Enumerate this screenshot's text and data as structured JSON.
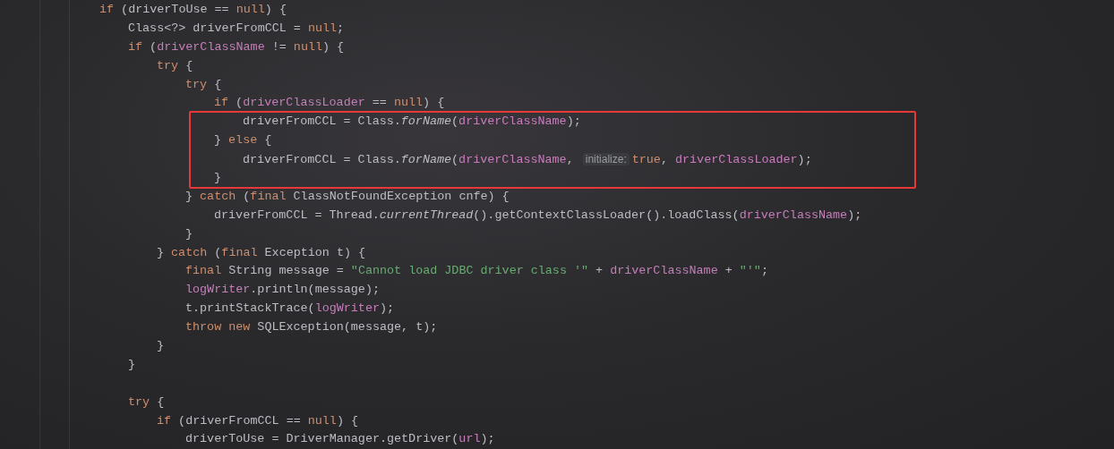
{
  "editor": {
    "lines": [
      {
        "kind": "code",
        "tokens": [
          {
            "kind": "keyword",
            "text": "if"
          },
          {
            "kind": "plain",
            "text": " (driverToUse == "
          },
          {
            "kind": "keyword",
            "text": "null"
          },
          {
            "kind": "plain",
            "text": ") {"
          }
        ],
        "children": [
          {
            "kind": "code",
            "tokens": [
              {
                "kind": "plain",
                "text": "Class<?> driverFromCCL = "
              },
              {
                "kind": "keyword",
                "text": "null"
              },
              {
                "kind": "plain",
                "text": ";"
              }
            ]
          },
          {
            "kind": "code",
            "tokens": [
              {
                "kind": "keyword",
                "text": "if"
              },
              {
                "kind": "plain",
                "text": " ("
              },
              {
                "kind": "field",
                "text": "driverClassName"
              },
              {
                "kind": "plain",
                "text": " != "
              },
              {
                "kind": "keyword",
                "text": "null"
              },
              {
                "kind": "plain",
                "text": ") {"
              }
            ],
            "children": [
              {
                "kind": "code",
                "tokens": [
                  {
                    "kind": "keyword",
                    "text": "try"
                  },
                  {
                    "kind": "plain",
                    "text": " {"
                  }
                ],
                "children": [
                  {
                    "kind": "code",
                    "tokens": [
                      {
                        "kind": "keyword",
                        "text": "try"
                      },
                      {
                        "kind": "plain",
                        "text": " {"
                      }
                    ],
                    "children": [
                      {
                        "kind": "code",
                        "tokens": [
                          {
                            "kind": "keyword",
                            "text": "if"
                          },
                          {
                            "kind": "plain",
                            "text": " ("
                          },
                          {
                            "kind": "field",
                            "text": "driverClassLoader"
                          },
                          {
                            "kind": "plain",
                            "text": " == "
                          },
                          {
                            "kind": "keyword",
                            "text": "null"
                          },
                          {
                            "kind": "plain",
                            "text": ") {"
                          }
                        ],
                        "children": [
                          {
                            "kind": "code",
                            "boxed": true,
                            "tokens": [
                              {
                                "kind": "plain",
                                "text": "driverFromCCL = Class."
                              },
                              {
                                "kind": "static",
                                "text": "forName"
                              },
                              {
                                "kind": "plain",
                                "text": "("
                              },
                              {
                                "kind": "field",
                                "text": "driverClassName"
                              },
                              {
                                "kind": "plain",
                                "text": ");"
                              }
                            ]
                          }
                        ]
                      },
                      {
                        "kind": "code",
                        "boxed": true,
                        "tokens": [
                          {
                            "kind": "plain",
                            "text": "} "
                          },
                          {
                            "kind": "keyword",
                            "text": "else"
                          },
                          {
                            "kind": "plain",
                            "text": " {"
                          }
                        ],
                        "children": [
                          {
                            "kind": "code",
                            "boxed": true,
                            "tokens": [
                              {
                                "kind": "plain",
                                "text": "driverFromCCL = Class."
                              },
                              {
                                "kind": "static",
                                "text": "forName"
                              },
                              {
                                "kind": "plain",
                                "text": "("
                              },
                              {
                                "kind": "field",
                                "text": "driverClassName"
                              },
                              {
                                "kind": "plain",
                                "text": ", "
                              },
                              {
                                "kind": "hint",
                                "text": "initialize:"
                              },
                              {
                                "kind": "keyword",
                                "text": "true"
                              },
                              {
                                "kind": "plain",
                                "text": ", "
                              },
                              {
                                "kind": "field",
                                "text": "driverClassLoader"
                              },
                              {
                                "kind": "plain",
                                "text": ");"
                              }
                            ]
                          }
                        ]
                      },
                      {
                        "kind": "code",
                        "boxed": true,
                        "tokens": [
                          {
                            "kind": "plain",
                            "text": "}"
                          }
                        ]
                      }
                    ]
                  },
                  {
                    "kind": "code",
                    "tokens": [
                      {
                        "kind": "plain",
                        "text": "} "
                      },
                      {
                        "kind": "keyword",
                        "text": "catch"
                      },
                      {
                        "kind": "plain",
                        "text": " ("
                      },
                      {
                        "kind": "keyword",
                        "text": "final"
                      },
                      {
                        "kind": "plain",
                        "text": " ClassNotFoundException cnfe) {"
                      }
                    ],
                    "children": [
                      {
                        "kind": "code",
                        "tokens": [
                          {
                            "kind": "plain",
                            "text": "driverFromCCL = Thread."
                          },
                          {
                            "kind": "static",
                            "text": "currentThread"
                          },
                          {
                            "kind": "plain",
                            "text": "().getContextClassLoader().loadClass("
                          },
                          {
                            "kind": "field",
                            "text": "driverClassName"
                          },
                          {
                            "kind": "plain",
                            "text": ");"
                          }
                        ]
                      }
                    ]
                  },
                  {
                    "kind": "code",
                    "tokens": [
                      {
                        "kind": "plain",
                        "text": "}"
                      }
                    ]
                  }
                ]
              },
              {
                "kind": "code",
                "tokens": [
                  {
                    "kind": "plain",
                    "text": "} "
                  },
                  {
                    "kind": "keyword",
                    "text": "catch"
                  },
                  {
                    "kind": "plain",
                    "text": " ("
                  },
                  {
                    "kind": "keyword",
                    "text": "final"
                  },
                  {
                    "kind": "plain",
                    "text": " Exception t) {"
                  }
                ],
                "children": [
                  {
                    "kind": "code",
                    "tokens": [
                      {
                        "kind": "keyword",
                        "text": "final"
                      },
                      {
                        "kind": "plain",
                        "text": " String message = "
                      },
                      {
                        "kind": "string",
                        "text": "\"Cannot load JDBC driver class '\""
                      },
                      {
                        "kind": "plain",
                        "text": " + "
                      },
                      {
                        "kind": "field",
                        "text": "driverClassName"
                      },
                      {
                        "kind": "plain",
                        "text": " + "
                      },
                      {
                        "kind": "string",
                        "text": "\"'\""
                      },
                      {
                        "kind": "plain",
                        "text": ";"
                      }
                    ]
                  },
                  {
                    "kind": "code",
                    "tokens": [
                      {
                        "kind": "field",
                        "text": "logWriter"
                      },
                      {
                        "kind": "plain",
                        "text": ".println(message);"
                      }
                    ]
                  },
                  {
                    "kind": "code",
                    "tokens": [
                      {
                        "kind": "plain",
                        "text": "t.printStackTrace("
                      },
                      {
                        "kind": "field",
                        "text": "logWriter"
                      },
                      {
                        "kind": "plain",
                        "text": ");"
                      }
                    ]
                  },
                  {
                    "kind": "code",
                    "tokens": [
                      {
                        "kind": "keyword",
                        "text": "throw new"
                      },
                      {
                        "kind": "plain",
                        "text": " SQLException(message, t);"
                      }
                    ]
                  }
                ]
              },
              {
                "kind": "code",
                "tokens": [
                  {
                    "kind": "plain",
                    "text": "}"
                  }
                ]
              }
            ]
          },
          {
            "kind": "code",
            "tokens": [
              {
                "kind": "plain",
                "text": "}"
              }
            ]
          },
          {
            "kind": "blank"
          },
          {
            "kind": "code",
            "tokens": [
              {
                "kind": "keyword",
                "text": "try"
              },
              {
                "kind": "plain",
                "text": " {"
              }
            ],
            "children": [
              {
                "kind": "code",
                "tokens": [
                  {
                    "kind": "keyword",
                    "text": "if"
                  },
                  {
                    "kind": "plain",
                    "text": " (driverFromCCL == "
                  },
                  {
                    "kind": "keyword",
                    "text": "null"
                  },
                  {
                    "kind": "plain",
                    "text": ") {"
                  }
                ],
                "children": [
                  {
                    "kind": "code",
                    "tokens": [
                      {
                        "kind": "plain",
                        "text": "driverToUse = DriverManager.getDriver("
                      },
                      {
                        "kind": "field",
                        "text": "url"
                      },
                      {
                        "kind": "plain",
                        "text": ");"
                      }
                    ]
                  }
                ]
              }
            ]
          }
        ]
      }
    ]
  }
}
